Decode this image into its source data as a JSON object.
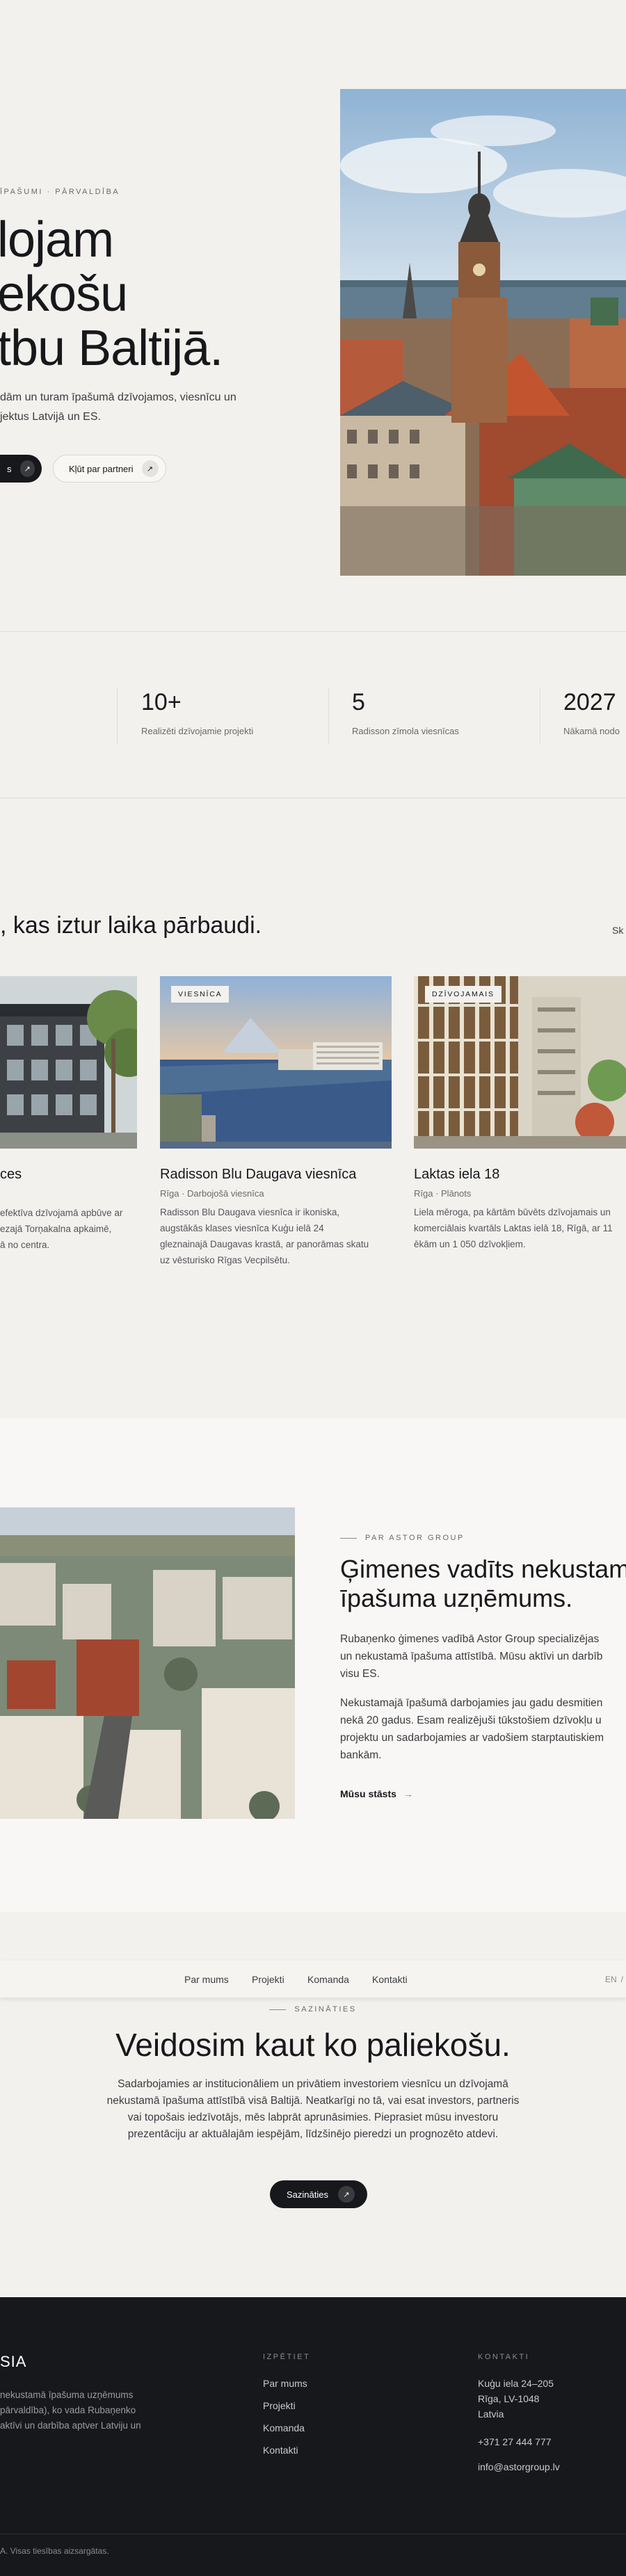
{
  "hero": {
    "eyebrow": "ĪPAŠUMI · PĀRVALDĪBA",
    "title_line1": "lojam",
    "title_line2": "ekošu",
    "title_line3": "tbu Baltijā.",
    "lead_line1": "dām un turam īpašumā dzīvojamos, viesnīcu un",
    "lead_line2": "jektus Latvijā un ES.",
    "primary_btn": "s",
    "secondary_btn": "Kļūt par partneri"
  },
  "stats": [
    {
      "value": "10+",
      "label": "Realizēti dzīvojamie projekti"
    },
    {
      "value": "5",
      "label": "Radisson zīmola viesnīcas"
    },
    {
      "value": "2027",
      "label": "Nākamā nodo"
    }
  ],
  "projects": {
    "heading": ", kas iztur laika pārbaudi.",
    "see_all": "Sk",
    "cards": [
      {
        "badge": "",
        "title": "ces",
        "meta": "",
        "desc1": "efektīva dzīvojamā apbūve ar",
        "desc2": "ezajā Torņakalna apkaimē,",
        "desc3": "ā no centra.",
        "desc4": ""
      },
      {
        "badge": "VIESNĪCA",
        "title": "Radisson Blu Daugava viesnīca",
        "meta": "Rīga · Darbojošā viesnīca",
        "desc1": "Radisson Blu Daugava viesnīca ir ikoniska,",
        "desc2": "augstākās klases viesnīca Kuģu ielā 24",
        "desc3": "gleznainajā Daugavas krastā, ar panorāmas skatu",
        "desc4": "uz vēsturisko Rīgas Vecpilsētu."
      },
      {
        "badge": "DZĪVOJAMAIS",
        "title": "Laktas iela 18",
        "meta": "Rīga · Plānots",
        "desc1": "Liela mēroga, pa kārtām būvēts dzīvojamais un",
        "desc2": "komerciālais kvartāls Laktas ielā 18, Rīgā, ar 11",
        "desc3": "ēkām un 1 050 dzīvokļiem.",
        "desc4": ""
      }
    ]
  },
  "about": {
    "eyebrow": "PAR ASTOR GROUP",
    "title_line1": "Ģimenes vadīts nekustam",
    "title_line2": "īpašuma uzņēmums.",
    "p1_line1": "Rubaņenko ģimenes vadībā Astor Group specializējas",
    "p1_line2": "un nekustamā īpašuma attīstībā. Mūsu aktīvi un darbīb",
    "p1_line3": "visu ES.",
    "p2_line1": "Nekustamajā īpašumā darbojamies jau gadu desmitien",
    "p2_line2": "nekā 20 gadus. Esam realizējuši tūkstošiem dzīvokļu u",
    "p2_line3": "projektu un sadarbojamies ar vadošiem starptautiskiem",
    "p2_line4": "bankām.",
    "link": "Mūsu stāsts"
  },
  "nav": {
    "items": [
      "Par mums",
      "Projekti",
      "Komanda",
      "Kontakti"
    ],
    "lang_en": "EN",
    "lang_sep": "/"
  },
  "contact": {
    "eyebrow": "SAZINĀTIES",
    "title": "Veidosim kaut ko paliekošu.",
    "p_line1": "Sadarbojamies ar institucionāliem un privātiem investoriem viesnīcu un dzīvojamā",
    "p_line2": "nekustamā īpašuma attīstībā visā Baltijā. Neatkarīgi no tā, vai esat investors, partneris",
    "p_line3": "vai topošais iedzīvotājs, mēs labprāt aprunāsimies. Pieprasiet mūsu investoru",
    "p_line4": "prezentāciju ar aktuālajām iespējām, līdzšinējo pieredzi un prognozēto atdevi.",
    "button": "Sazināties"
  },
  "footer": {
    "brand": "SIA",
    "brand_desc1": "nekustamā īpašuma uzņēmums",
    "brand_desc2": "pārvaldība), ko vada Rubaņenko",
    "brand_desc3": "aktīvi un darbība aptver Latviju un",
    "col1_title": "IZPĒTIET",
    "col1_links": [
      "Par mums",
      "Projekti",
      "Komanda",
      "Kontakti"
    ],
    "col2_title": "KONTAKTI",
    "address1": "Kuģu iela 24–205",
    "address2": "Rīga, LV-1048",
    "address3": "Latvia",
    "phone": "+371 27 444 777",
    "email": "info@astorgroup.lv",
    "copyright": "A. Visas tiesības aizsargātas."
  }
}
